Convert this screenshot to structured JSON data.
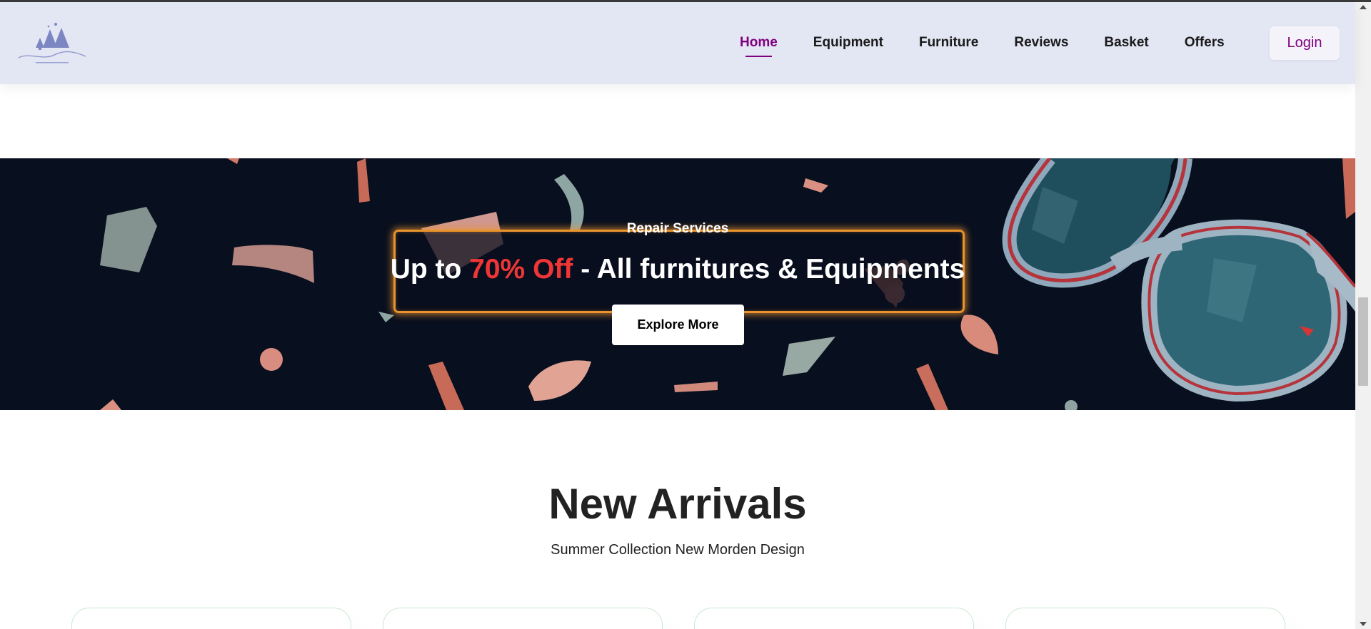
{
  "header": {
    "logo_alt": "Jessie's Camping Company",
    "nav": [
      {
        "label": "Home",
        "active": true
      },
      {
        "label": "Equipment"
      },
      {
        "label": "Furniture"
      },
      {
        "label": "Reviews"
      },
      {
        "label": "Basket"
      },
      {
        "label": "Offers"
      }
    ],
    "login_label": "Login"
  },
  "banner": {
    "subtitle": "Repair Services",
    "offer_prefix": "Up to ",
    "offer_highlight": "70% Off",
    "offer_suffix": " - All furnitures & Equipments",
    "cta_label": "Explore More"
  },
  "new_arrivals": {
    "title": "New Arrivals",
    "subtitle": "Summer Collection New Morden Design"
  },
  "colors": {
    "header_bg": "#e3e6f3",
    "accent": "#800080",
    "banner_bg": "#080f1e",
    "highlight": "#ef3636",
    "glow": "#e8932b"
  }
}
